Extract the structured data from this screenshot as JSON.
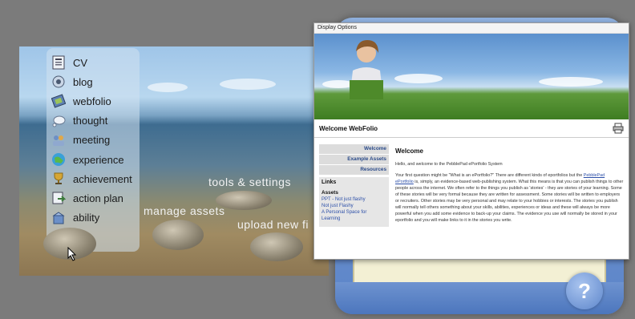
{
  "menu": {
    "items": [
      {
        "label": "CV",
        "icon": "cv-icon"
      },
      {
        "label": "blog",
        "icon": "blog-icon"
      },
      {
        "label": "webfolio",
        "icon": "webfolio-icon"
      },
      {
        "label": "thought",
        "icon": "thought-icon"
      },
      {
        "label": "meeting",
        "icon": "meeting-icon"
      },
      {
        "label": "experience",
        "icon": "experience-icon"
      },
      {
        "label": "achievement",
        "icon": "achievement-icon"
      },
      {
        "label": "action plan",
        "icon": "action-plan-icon"
      },
      {
        "label": "ability",
        "icon": "ability-icon"
      }
    ]
  },
  "scene": {
    "tools_settings": "tools & settings",
    "manage_assets": "manage assets",
    "upload_new_file": "upload new fi"
  },
  "window": {
    "titlebar": "Display Options",
    "welcome_title": "Welcome WebFolio",
    "nav": {
      "welcome": "Welcome",
      "example_assets": "Example Assets",
      "resources": "Resources"
    },
    "links": {
      "title": "Links",
      "assets_title": "Assets",
      "items": [
        "PPT - Not just flashy",
        "Not just Flashy",
        "A Personal Space for Learning"
      ]
    },
    "main": {
      "heading": "Welcome",
      "intro": "Hello, and welcome to the PebblePad ePortfolio System",
      "para1_a": "Your first question might be \"What is an ePortfolio?\" There are different kinds of eportfolios but the ",
      "para1_link": "PebblePad ePortfolio",
      "para1_b": " is, simply, an evidence-based web-publishing system. What this means is that you can publish things to other people across the internet. We often refer to the things you publish as 'stories' - they are stories of your learning. Some of these stories will be very formal because they are written for assessment. Some stories will be written to employers or recruiters. Other stories may be very personal and may relate to your hobbies or interests. The stories you publish will normally tell others something about your skills, abilities, experiences or ideas and these will always be more powerful when you add some evidence to back-up your claims. The evidence you use will normally be stored in your eportfolio and you will make links to it in the stories you write."
    }
  },
  "help": {
    "label": "?"
  }
}
